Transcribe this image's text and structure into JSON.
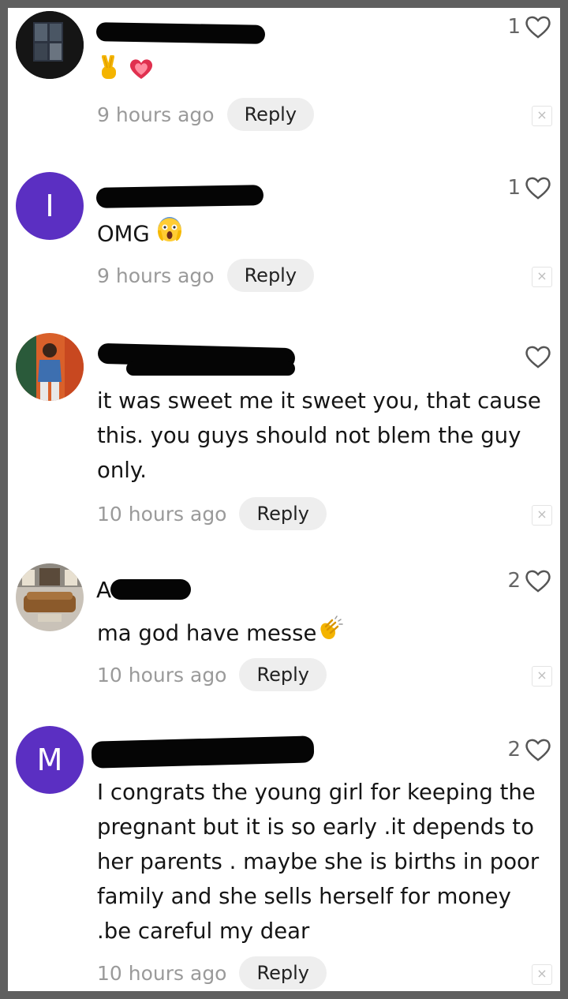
{
  "comments": [
    {
      "author": "",
      "avatar": "",
      "text": "",
      "time": "9 hours ago",
      "likes": "1",
      "reply_label": "Reply",
      "close_glyph": "×"
    },
    {
      "author": "",
      "avatar": "I",
      "text": "OMG",
      "time": "9 hours ago",
      "likes": "1",
      "reply_label": "Reply",
      "close_glyph": "×"
    },
    {
      "author": "",
      "avatar": "",
      "text": "it was sweet me it sweet you, that cause this. you guys should not blem the guy only.",
      "time": "10 hours ago",
      "likes": "",
      "reply_label": "Reply",
      "close_glyph": "×"
    },
    {
      "author": "A",
      "avatar": "",
      "text": "ma god have messe",
      "time": "10 hours ago",
      "likes": "2",
      "reply_label": "Reply",
      "close_glyph": "×"
    },
    {
      "author": "",
      "avatar": "M",
      "text": "I congrats the young girl for keeping the pregnant but it is so early .it depends to her parents . maybe she is births in poor family and she sells herself for money .be careful my dear",
      "time": "10 hours ago",
      "likes": "2",
      "reply_label": "Reply",
      "close_glyph": "×"
    }
  ],
  "icons": {
    "like": "heart-outline-icon",
    "emoji_1": "victory-hand-icon",
    "emoji_2": "sparkling-heart-icon",
    "emoji_3": "screaming-face-icon",
    "emoji_4": "clapping-hands-icon",
    "close": "close-icon"
  },
  "colors": {
    "letter_avatar": "#5b2fc2",
    "timestamp": "#9a9a9a",
    "reply_bg": "#eeeeee",
    "heart_stroke": "#555555"
  }
}
